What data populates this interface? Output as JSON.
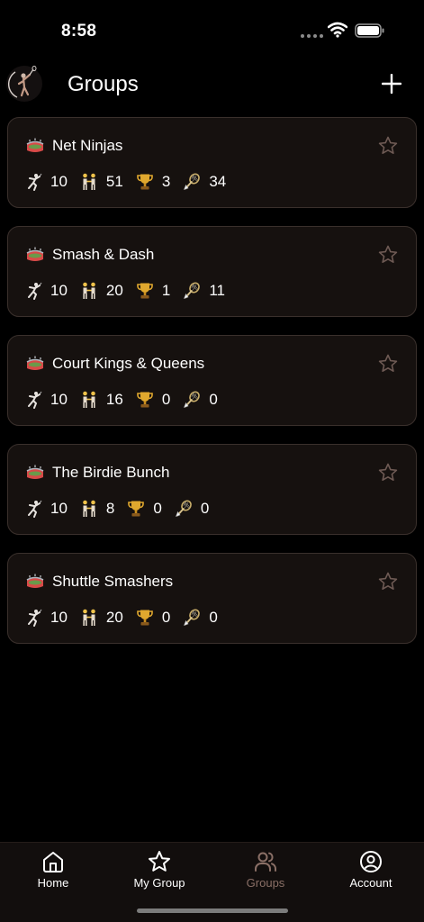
{
  "status_bar": {
    "time": "8:58"
  },
  "header": {
    "title": "Groups"
  },
  "groups": [
    {
      "name": "Net Ninjas",
      "stats": {
        "players": "10",
        "members": "51",
        "trophies": "3",
        "matches": "34"
      }
    },
    {
      "name": "Smash & Dash",
      "stats": {
        "players": "10",
        "members": "20",
        "trophies": "1",
        "matches": "11"
      }
    },
    {
      "name": "Court Kings & Queens",
      "stats": {
        "players": "10",
        "members": "16",
        "trophies": "0",
        "matches": "0"
      }
    },
    {
      "name": "The Birdie Bunch",
      "stats": {
        "players": "10",
        "members": "8",
        "trophies": "0",
        "matches": "0"
      }
    },
    {
      "name": "Shuttle Smashers",
      "stats": {
        "players": "10",
        "members": "20",
        "trophies": "0",
        "matches": "0"
      }
    }
  ],
  "nav": {
    "items": [
      {
        "label": "Home",
        "icon": "home-icon"
      },
      {
        "label": "My Group",
        "icon": "star-icon"
      },
      {
        "label": "Groups",
        "icon": "users-icon"
      },
      {
        "label": "Account",
        "icon": "account-icon"
      }
    ],
    "active": "Groups"
  },
  "colors": {
    "background": "#000000",
    "card": "#16110f",
    "card_border": "#3a302c",
    "active_tab": "#8a6f66",
    "trophy": "#e0a82e"
  }
}
